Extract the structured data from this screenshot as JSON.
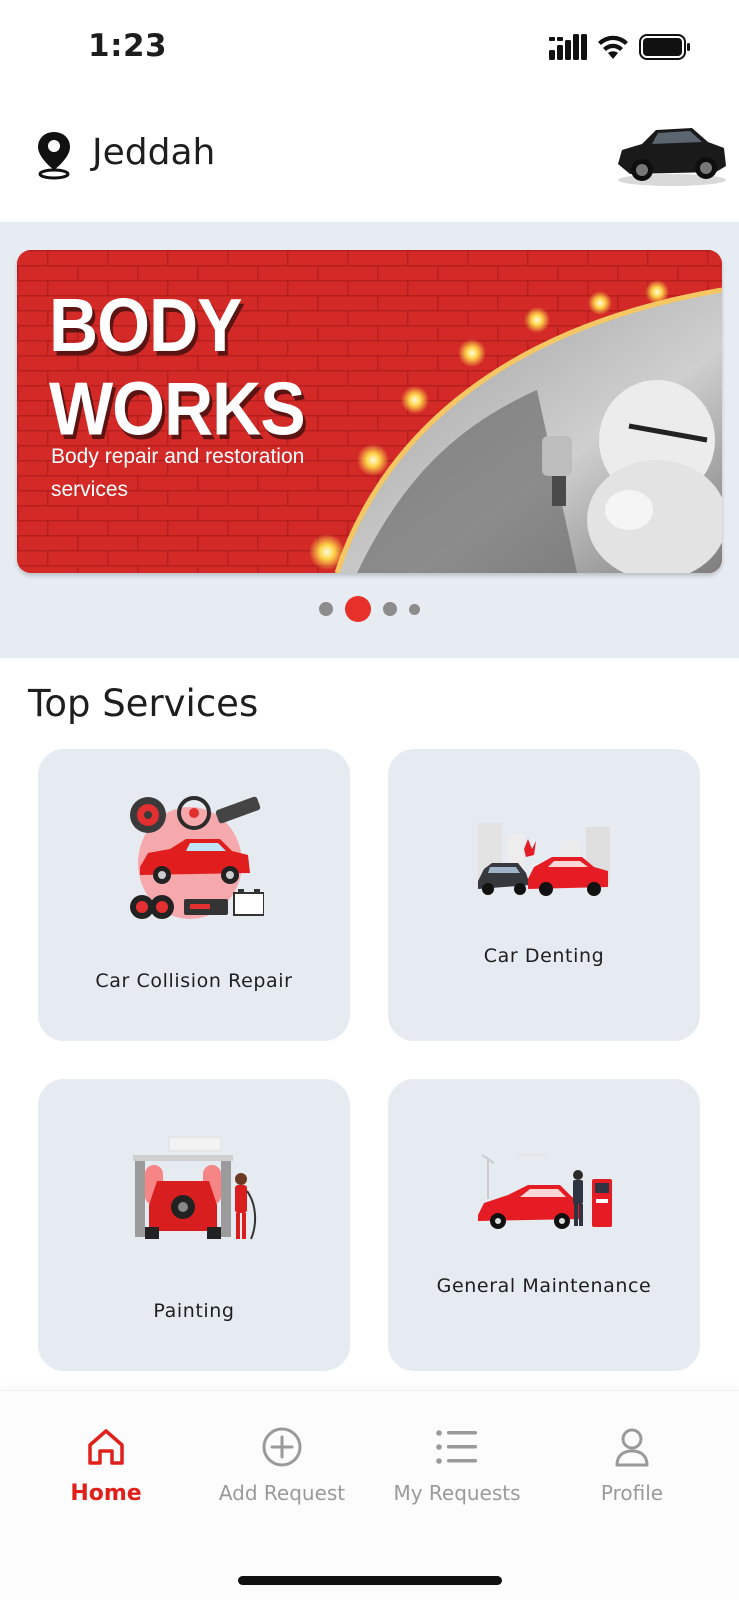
{
  "status_bar": {
    "time": "1:23",
    "icons": [
      "cellular-signal-icon",
      "wifi-icon",
      "battery-icon"
    ]
  },
  "header": {
    "location_icon": "location-pin-icon",
    "city": "Jeddah",
    "avatar_icon": "car-avatar-icon"
  },
  "banner": {
    "title_line1": "BODY",
    "title_line2": "WORKS",
    "subtitle": "Body repair and restoration services",
    "slide_count": 4,
    "active_slide": 2,
    "colors": {
      "background": "#d32a28",
      "active_dot": "#e8302a",
      "inactive_dot": "#8c8c8c"
    }
  },
  "top_services": {
    "title": "Top Services",
    "items": [
      {
        "label": "Car Collision Repair",
        "icon": "car-parts-icon"
      },
      {
        "label": "Car Denting",
        "icon": "car-crash-icon"
      },
      {
        "label": "Painting",
        "icon": "car-wash-painting-icon"
      },
      {
        "label": "General Maintenance",
        "icon": "car-charging-icon"
      }
    ]
  },
  "bottom_nav": {
    "items": [
      {
        "label": "Home",
        "icon": "home-icon",
        "active": true
      },
      {
        "label": "Add Request",
        "icon": "plus-circle-icon",
        "active": false
      },
      {
        "label": "My Requests",
        "icon": "list-icon",
        "active": false
      },
      {
        "label": "Profile",
        "icon": "user-icon",
        "active": false
      }
    ],
    "active_color": "#e0201b",
    "inactive_color": "#9a9a9a"
  }
}
